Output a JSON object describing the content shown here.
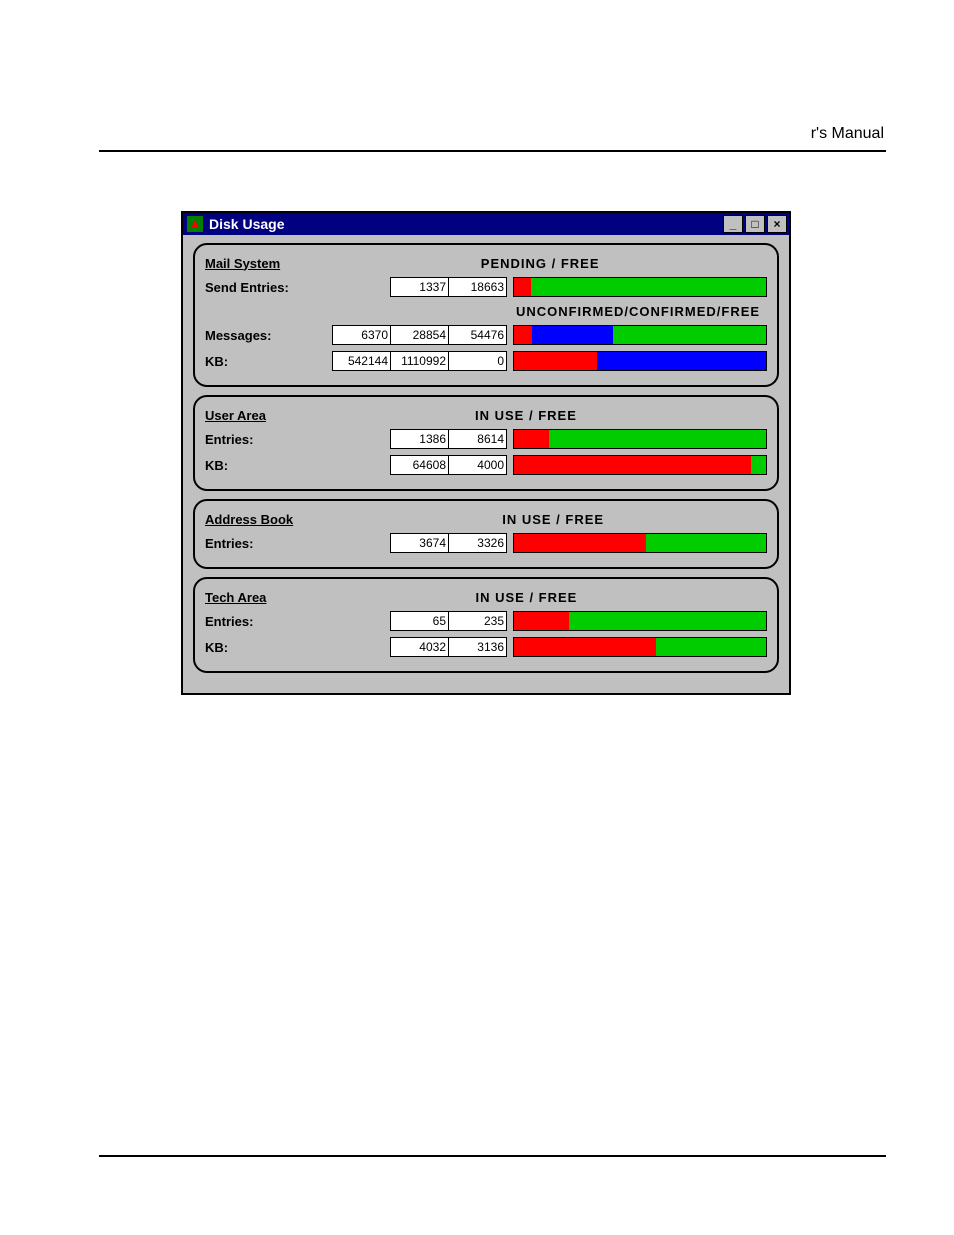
{
  "page_header_right": "r's Manual",
  "window_title": "Disk Usage",
  "colors": {
    "red": "#ff0000",
    "green": "#00cc00",
    "blue": "#0000ff"
  },
  "sections": {
    "mail": {
      "title": "Mail System",
      "legend1": "PENDING    /    FREE",
      "legend2": "UNCONFIRMED/CONFIRMED/FREE",
      "rows": {
        "send": {
          "label": "Send Entries:",
          "cells": [
            "1337",
            "18663"
          ],
          "bar": [
            {
              "c": "#ff0000",
              "v": 1337
            },
            {
              "c": "#00cc00",
              "v": 18663
            }
          ]
        },
        "msgs": {
          "label": "Messages:",
          "cells": [
            "6370",
            "28854",
            "54476"
          ],
          "bar": [
            {
              "c": "#ff0000",
              "v": 6370
            },
            {
              "c": "#0000ff",
              "v": 28854
            },
            {
              "c": "#00cc00",
              "v": 54476
            }
          ]
        },
        "kb": {
          "label": "KB:",
          "cells": [
            "542144",
            "1110992",
            "0"
          ],
          "bar": [
            {
              "c": "#ff0000",
              "v": 542144
            },
            {
              "c": "#0000ff",
              "v": 1110992
            },
            {
              "c": "#00cc00",
              "v": 0
            }
          ]
        }
      }
    },
    "user": {
      "title": "User Area",
      "legend": "IN USE    /    FREE",
      "rows": {
        "entries": {
          "label": "Entries:",
          "cells": [
            "1386",
            "8614"
          ],
          "bar": [
            {
              "c": "#ff0000",
              "v": 1386
            },
            {
              "c": "#00cc00",
              "v": 8614
            }
          ]
        },
        "kb": {
          "label": "KB:",
          "cells": [
            "64608",
            "4000"
          ],
          "bar": [
            {
              "c": "#ff0000",
              "v": 64608
            },
            {
              "c": "#00cc00",
              "v": 4000
            }
          ]
        }
      }
    },
    "addr": {
      "title": "Address Book",
      "legend": "IN USE    /    FREE",
      "rows": {
        "entries": {
          "label": "Entries:",
          "cells": [
            "3674",
            "3326"
          ],
          "bar": [
            {
              "c": "#ff0000",
              "v": 3674
            },
            {
              "c": "#00cc00",
              "v": 3326
            }
          ]
        }
      }
    },
    "tech": {
      "title": "Tech Area",
      "legend": "IN USE    /    FREE",
      "rows": {
        "entries": {
          "label": "Entries:",
          "cells": [
            "65",
            "235"
          ],
          "bar": [
            {
              "c": "#ff0000",
              "v": 65
            },
            {
              "c": "#00cc00",
              "v": 235
            }
          ]
        },
        "kb": {
          "label": "KB:",
          "cells": [
            "4032",
            "3136"
          ],
          "bar": [
            {
              "c": "#ff0000",
              "v": 4032
            },
            {
              "c": "#00cc00",
              "v": 3136
            }
          ]
        }
      }
    }
  },
  "chart_data": [
    {
      "type": "bar",
      "title": "Mail System – Send Entries",
      "categories": [
        "Pending",
        "Free"
      ],
      "values": [
        1337,
        18663
      ]
    },
    {
      "type": "bar",
      "title": "Mail System – Messages",
      "categories": [
        "Unconfirmed",
        "Confirmed",
        "Free"
      ],
      "values": [
        6370,
        28854,
        54476
      ]
    },
    {
      "type": "bar",
      "title": "Mail System – KB",
      "categories": [
        "Unconfirmed",
        "Confirmed",
        "Free"
      ],
      "values": [
        542144,
        1110992,
        0
      ]
    },
    {
      "type": "bar",
      "title": "User Area – Entries",
      "categories": [
        "In Use",
        "Free"
      ],
      "values": [
        1386,
        8614
      ]
    },
    {
      "type": "bar",
      "title": "User Area – KB",
      "categories": [
        "In Use",
        "Free"
      ],
      "values": [
        64608,
        4000
      ]
    },
    {
      "type": "bar",
      "title": "Address Book – Entries",
      "categories": [
        "In Use",
        "Free"
      ],
      "values": [
        3674,
        3326
      ]
    },
    {
      "type": "bar",
      "title": "Tech Area – Entries",
      "categories": [
        "In Use",
        "Free"
      ],
      "values": [
        65,
        235
      ]
    },
    {
      "type": "bar",
      "title": "Tech Area – KB",
      "categories": [
        "In Use",
        "Free"
      ],
      "values": [
        4032,
        3136
      ]
    }
  ]
}
